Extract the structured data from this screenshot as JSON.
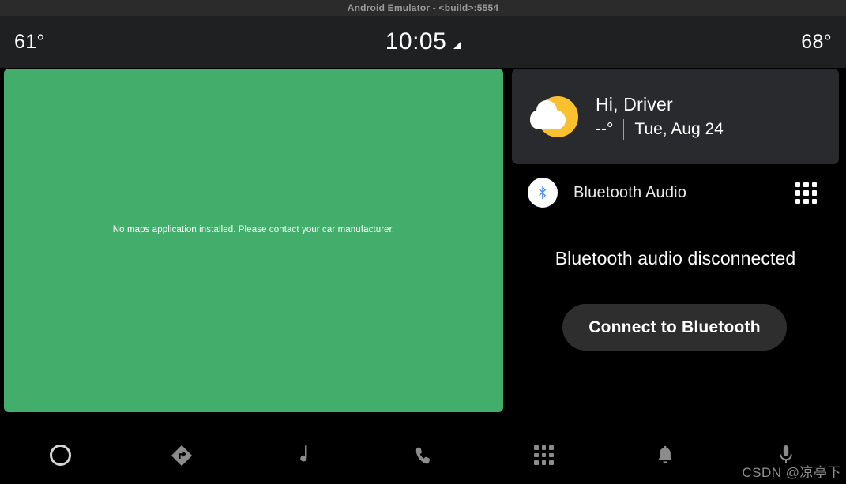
{
  "emulator": {
    "window_title": "Android Emulator - <build>:5554"
  },
  "status_bar": {
    "temp_left": "61°",
    "clock": "10:05",
    "temp_right": "68°",
    "signal_icon": "signal-triangle-icon"
  },
  "map_panel": {
    "message": "No maps application installed. Please contact your car manufacturer.",
    "background_color": "#43ae6b"
  },
  "weather_card": {
    "icon": "sun-behind-cloud-icon",
    "greeting": "Hi, Driver",
    "temperature": "--°",
    "date": "Tue, Aug 24",
    "background_color": "#292a2d"
  },
  "media_card": {
    "source_icon": "bluetooth-icon",
    "source_name": "Bluetooth Audio",
    "grid_icon": "app-grid-icon",
    "status": "Bluetooth audio disconnected",
    "connect_button": "Connect to Bluetooth",
    "button_color": "#2e2e2e"
  },
  "nav_bar": {
    "items": [
      {
        "name": "home",
        "icon": "home-circle-icon",
        "label": "Home",
        "active": true
      },
      {
        "name": "navigation",
        "icon": "navigation-diamond-icon",
        "label": "Navigation",
        "active": false
      },
      {
        "name": "media",
        "icon": "music-note-icon",
        "label": "Media",
        "active": false
      },
      {
        "name": "phone",
        "icon": "phone-handset-icon",
        "label": "Phone",
        "active": false
      },
      {
        "name": "apps",
        "icon": "app-grid-icon",
        "label": "Apps",
        "active": false
      },
      {
        "name": "notifications",
        "icon": "bell-icon",
        "label": "Notifications",
        "active": false
      },
      {
        "name": "assistant",
        "icon": "microphone-icon",
        "label": "Assistant",
        "active": false
      }
    ]
  },
  "watermark": {
    "text": "CSDN @凉亭下"
  }
}
